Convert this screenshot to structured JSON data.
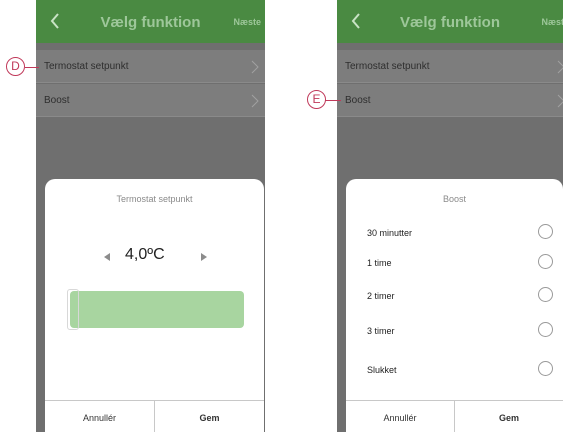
{
  "left_screen": {
    "nav": {
      "title": "Vælg funktion",
      "next": "Næste"
    },
    "rows": [
      {
        "label": "Termostat setpunkt"
      },
      {
        "label": "Boost"
      }
    ],
    "sheet": {
      "title": "Termostat setpunkt",
      "temperature": "4,0ºC",
      "cancel": "Annullér",
      "save": "Gem"
    }
  },
  "right_screen": {
    "nav": {
      "title": "Vælg funktion",
      "next": "Næste"
    },
    "rows": [
      {
        "label": "Termostat setpunkt"
      },
      {
        "label": "Boost"
      }
    ],
    "sheet": {
      "title": "Boost",
      "options": [
        {
          "label": "30 minutter"
        },
        {
          "label": "1 time"
        },
        {
          "label": "2 timer"
        },
        {
          "label": "3 timer"
        },
        {
          "label": "Slukket"
        }
      ],
      "cancel": "Annullér",
      "save": "Gem"
    }
  },
  "callouts": {
    "d": "D",
    "e": "E"
  },
  "colors": {
    "accent": "#c0395a",
    "nav_bg": "#4a8a42",
    "slider_fill": "#a8d5a0"
  }
}
